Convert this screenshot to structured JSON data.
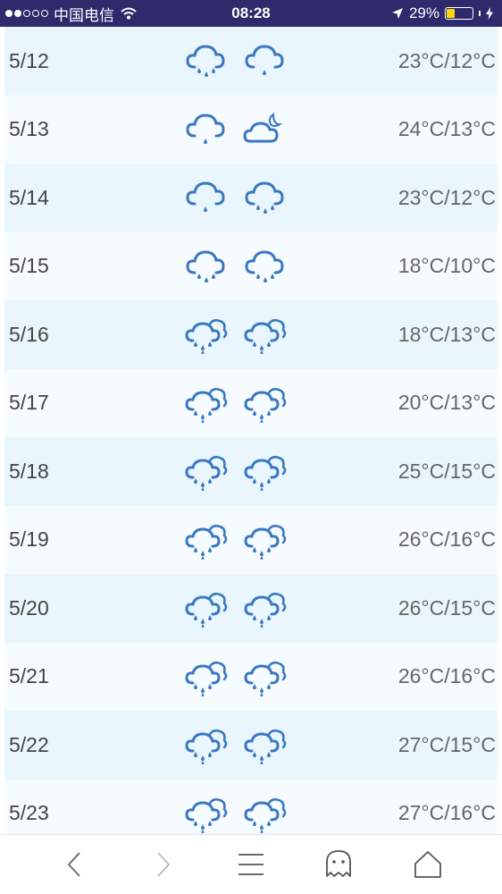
{
  "status_bar": {
    "carrier": "中国电信",
    "time": "08:28",
    "battery": "29%",
    "battery_level": 0.29
  },
  "forecast": [
    {
      "date": "5/12",
      "temp": "23°C/12°C",
      "icon_day": "rain-icon",
      "icon_night": "light-rain-icon"
    },
    {
      "date": "5/13",
      "temp": "24°C/13°C",
      "icon_day": "light-rain-icon",
      "icon_night": "cloudy-night-icon"
    },
    {
      "date": "5/14",
      "temp": "23°C/12°C",
      "icon_day": "light-rain-icon",
      "icon_night": "rain-icon"
    },
    {
      "date": "5/15",
      "temp": "18°C/10°C",
      "icon_day": "rain-icon",
      "icon_night": "rain-icon"
    },
    {
      "date": "5/16",
      "temp": "18°C/13°C",
      "icon_day": "rain-shower-icon",
      "icon_night": "rain-shower-icon"
    },
    {
      "date": "5/17",
      "temp": "20°C/13°C",
      "icon_day": "rain-shower-icon",
      "icon_night": "rain-shower-icon"
    },
    {
      "date": "5/18",
      "temp": "25°C/15°C",
      "icon_day": "rain-shower-icon",
      "icon_night": "rain-shower-icon"
    },
    {
      "date": "5/19",
      "temp": "26°C/16°C",
      "icon_day": "rain-shower-icon",
      "icon_night": "rain-shower-icon"
    },
    {
      "date": "5/20",
      "temp": "26°C/15°C",
      "icon_day": "rain-shower-icon",
      "icon_night": "rain-shower-icon"
    },
    {
      "date": "5/21",
      "temp": "26°C/16°C",
      "icon_day": "rain-shower-icon",
      "icon_night": "rain-shower-icon"
    },
    {
      "date": "5/22",
      "temp": "27°C/15°C",
      "icon_day": "rain-shower-icon",
      "icon_night": "rain-shower-icon"
    },
    {
      "date": "5/23",
      "temp": "27°C/16°C",
      "icon_day": "rain-shower-icon",
      "icon_night": "rain-shower-icon"
    }
  ],
  "toolbar": {
    "items": [
      "back-icon",
      "forward-icon",
      "menu-icon",
      "ghost-icon",
      "home-icon"
    ]
  },
  "colors": {
    "status_bar": "#2e2a6b",
    "icon_blue": "#3a78c2",
    "row_light": "#e9f6fd",
    "row_lighter": "#f6fbff"
  }
}
